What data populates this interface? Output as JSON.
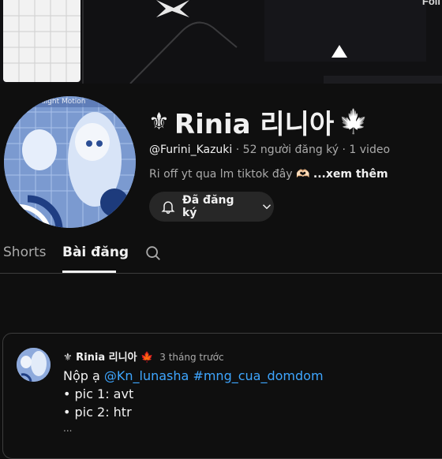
{
  "banner": {
    "corner_text": "Foll"
  },
  "channel": {
    "name": "Rinia 리니아",
    "prefix_symbol": "⚜",
    "suffix_symbol": "🍁",
    "handle": "@Furini_Kazuki",
    "subscribers": "52 người đăng ký",
    "videos": "1 video",
    "separator": "·",
    "description": "Ri off yt qua lm tiktok đây 🫶🏻",
    "more_label": "...xem thêm",
    "avatar_overlay_text": "Alight Motion"
  },
  "subscribe": {
    "label": "Đã đăng ký"
  },
  "tabs": [
    {
      "label": "Shorts",
      "active": false
    },
    {
      "label": "Bài đăng",
      "active": true
    }
  ],
  "post": {
    "author": "⚜ Rinia 리니아 🍁",
    "time": "3 tháng trước",
    "line1_prefix": "Nộp ạ ",
    "mention": "@Kn_lunasha",
    "hashtag": "#mng_cua_domdom",
    "bullets": [
      "• pic 1: avt",
      "• pic 2: htr"
    ],
    "truncated": "..."
  },
  "colors": {
    "background": "#0f0f0f",
    "text_primary": "#f1f1f1",
    "text_secondary": "#aaaaaa",
    "button_bg": "#272727",
    "link": "#3ea6ff",
    "divider": "#3d3d3d"
  },
  "icons": [
    "bell-icon",
    "chevron-down-icon",
    "search-icon",
    "fleur-de-lis-icon",
    "maple-leaf-icon"
  ]
}
